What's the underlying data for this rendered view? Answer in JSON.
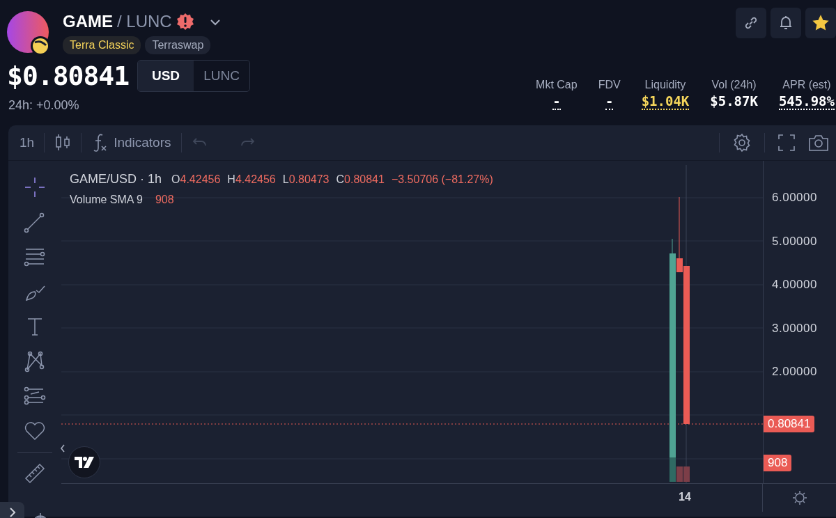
{
  "header": {
    "base_symbol": "GAME",
    "quote_symbol": "/ LUNC",
    "tags": [
      {
        "label": "Terra Classic",
        "kind": "chain"
      },
      {
        "label": "Terraswap",
        "kind": "dex"
      }
    ],
    "price": "$0.80841",
    "change": "24h: +0.00%",
    "currency_toggle": [
      {
        "label": "USD",
        "selected": true
      },
      {
        "label": "LUNC",
        "selected": false
      }
    ],
    "favorite": {
      "on": true
    },
    "stats": [
      {
        "label": "Mkt Cap",
        "value": "-",
        "kind": "dotted"
      },
      {
        "label": "FDV",
        "value": "-",
        "kind": "dotted"
      },
      {
        "label": "Liquidity",
        "value": "$1.04K",
        "kind": "highlight"
      },
      {
        "label": "Vol (24h)",
        "value": "$5.87K",
        "kind": "plain"
      },
      {
        "label": "APR (est)",
        "value": "545.98%",
        "kind": "dotted"
      }
    ]
  },
  "toolbar": {
    "interval": "1h",
    "indicators_label": "Indicators",
    "undo": {
      "disabled": true
    },
    "redo": {
      "disabled": true
    }
  },
  "legend": {
    "symbol": "GAME/USD · 1h",
    "ohlc": [
      {
        "key": "O",
        "value": "4.42456"
      },
      {
        "key": "H",
        "value": "4.42456"
      },
      {
        "key": "L",
        "value": "0.80473"
      },
      {
        "key": "C",
        "value": "0.80841"
      }
    ],
    "change": "−3.50706 (−81.27%)",
    "indicator": "Volume SMA 9",
    "indicator_value": "908"
  },
  "price_axis": [
    "6.00000",
    "5.00000",
    "4.00000",
    "3.00000",
    "2.00000"
  ],
  "last_price_badge": "0.80841",
  "volume_badge": "908",
  "time_axis": [
    "14"
  ]
}
